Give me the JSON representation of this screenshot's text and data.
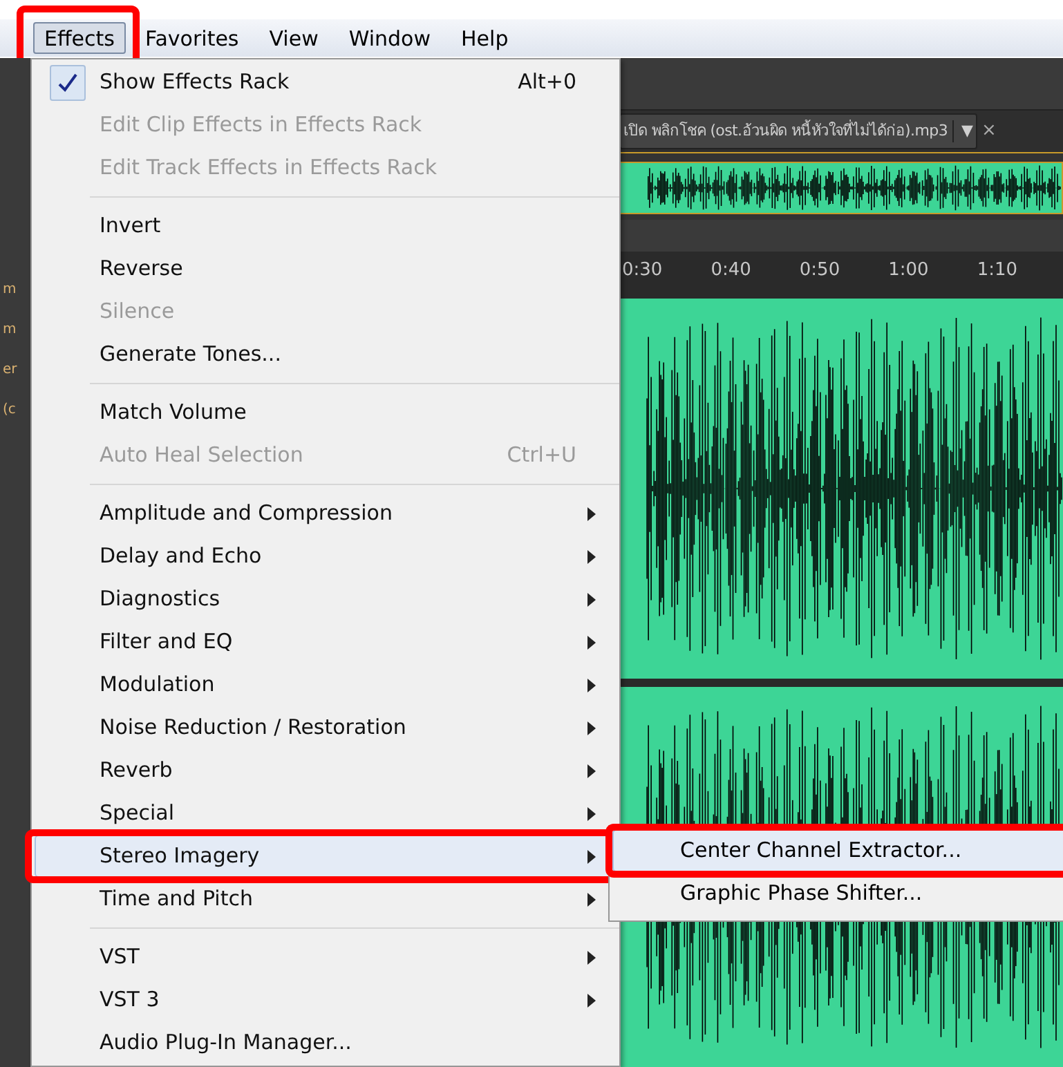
{
  "menubar": [
    {
      "label": "Effects",
      "selected": true,
      "annotated": true
    },
    {
      "label": "Favorites",
      "selected": false,
      "annotated": false
    },
    {
      "label": "View",
      "selected": false,
      "annotated": false
    },
    {
      "label": "Window",
      "selected": false,
      "annotated": false
    },
    {
      "label": "Help",
      "selected": false,
      "annotated": false
    }
  ],
  "side_fragments": [
    "m",
    "m",
    "er",
    "(c"
  ],
  "file_tab": {
    "label": "เปิด พลิกโชค (ost.อ้วนผิด หนี้หัวใจที่ไม่ได้ก่อ).mp3",
    "dropdown": "▼",
    "close": "×"
  },
  "ruler": [
    "0:30",
    "0:40",
    "0:50",
    "1:00",
    "1:10"
  ],
  "menu": [
    [
      {
        "label": "Show Effects Rack",
        "shortcut": "Alt+0",
        "checked": true,
        "disabled": false,
        "submenu": false,
        "selected": false,
        "annotated": false
      },
      {
        "label": "Edit Clip Effects in Effects Rack",
        "checked": false,
        "disabled": true,
        "submenu": false,
        "selected": false,
        "annotated": false
      },
      {
        "label": "Edit Track Effects in Effects Rack",
        "checked": false,
        "disabled": true,
        "submenu": false,
        "selected": false,
        "annotated": false
      }
    ],
    [
      {
        "label": "Invert",
        "checked": false,
        "disabled": false,
        "submenu": false,
        "selected": false,
        "annotated": false
      },
      {
        "label": "Reverse",
        "checked": false,
        "disabled": false,
        "submenu": false,
        "selected": false,
        "annotated": false
      },
      {
        "label": "Silence",
        "checked": false,
        "disabled": true,
        "submenu": false,
        "selected": false,
        "annotated": false
      },
      {
        "label": "Generate Tones...",
        "checked": false,
        "disabled": false,
        "submenu": false,
        "selected": false,
        "annotated": false
      }
    ],
    [
      {
        "label": "Match Volume",
        "checked": false,
        "disabled": false,
        "submenu": false,
        "selected": false,
        "annotated": false
      },
      {
        "label": "Auto Heal Selection",
        "shortcut": "Ctrl+U",
        "checked": false,
        "disabled": true,
        "submenu": false,
        "selected": false,
        "annotated": false
      }
    ],
    [
      {
        "label": "Amplitude and Compression",
        "checked": false,
        "disabled": false,
        "submenu": true,
        "selected": false,
        "annotated": false
      },
      {
        "label": "Delay and Echo",
        "checked": false,
        "disabled": false,
        "submenu": true,
        "selected": false,
        "annotated": false
      },
      {
        "label": "Diagnostics",
        "checked": false,
        "disabled": false,
        "submenu": true,
        "selected": false,
        "annotated": false
      },
      {
        "label": "Filter and EQ",
        "checked": false,
        "disabled": false,
        "submenu": true,
        "selected": false,
        "annotated": false
      },
      {
        "label": "Modulation",
        "checked": false,
        "disabled": false,
        "submenu": true,
        "selected": false,
        "annotated": false
      },
      {
        "label": "Noise Reduction / Restoration",
        "checked": false,
        "disabled": false,
        "submenu": true,
        "selected": false,
        "annotated": false
      },
      {
        "label": "Reverb",
        "checked": false,
        "disabled": false,
        "submenu": true,
        "selected": false,
        "annotated": false
      },
      {
        "label": "Special",
        "checked": false,
        "disabled": false,
        "submenu": true,
        "selected": false,
        "annotated": false
      },
      {
        "label": "Stereo Imagery",
        "checked": false,
        "disabled": false,
        "submenu": true,
        "selected": true,
        "annotated": true
      },
      {
        "label": "Time and Pitch",
        "checked": false,
        "disabled": false,
        "submenu": true,
        "selected": false,
        "annotated": false
      }
    ],
    [
      {
        "label": "VST",
        "checked": false,
        "disabled": false,
        "submenu": true,
        "selected": false,
        "annotated": false
      },
      {
        "label": "VST 3",
        "checked": false,
        "disabled": false,
        "submenu": true,
        "selected": false,
        "annotated": false
      },
      {
        "label": "Audio Plug-In Manager...",
        "checked": false,
        "disabled": false,
        "submenu": false,
        "selected": false,
        "annotated": false
      }
    ]
  ],
  "submenu": [
    {
      "label": "Center Channel Extractor...",
      "selected": true,
      "annotated": true
    },
    {
      "label": "Graphic Phase Shifter...",
      "selected": false,
      "annotated": false
    }
  ]
}
